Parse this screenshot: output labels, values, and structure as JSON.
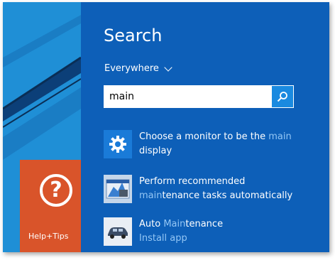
{
  "search": {
    "title": "Search",
    "scope": "Everywhere",
    "query": "main"
  },
  "results": [
    {
      "text_before": "Choose a monitor to be the ",
      "highlight": "main",
      "text_after": " display",
      "icon": "gear-icon"
    },
    {
      "text_before": "Perform recommended ",
      "highlight": "main",
      "text_after": "tenance tasks automatically",
      "icon": "maintenance-icon"
    },
    {
      "text_before": "Auto ",
      "highlight": "Main",
      "text_after": "tenance",
      "sub": "Install app",
      "icon": "car-icon"
    }
  ],
  "tile": {
    "label": "Help+Tips",
    "icon": "question-icon"
  },
  "colors": {
    "pane": "#0d5fb8",
    "desktop": "#1f8fd6",
    "tile": "#d9542a",
    "highlight": "#93c6f5",
    "search_button": "#1a8ae0"
  }
}
